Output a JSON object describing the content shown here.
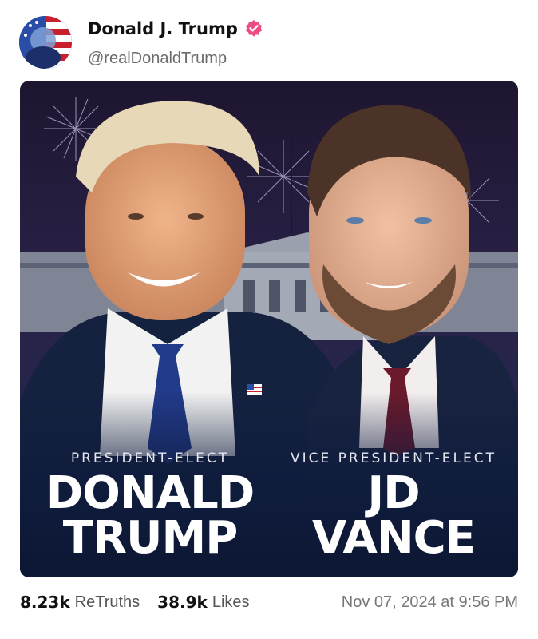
{
  "post": {
    "author_name": "Donald J. Trump",
    "author_handle": "@realDonaldTrump",
    "verified": true,
    "accent_color": "#ec4c86"
  },
  "media": {
    "left": {
      "role": "PRESIDENT-ELECT",
      "name_line1": "DONALD",
      "name_line2": "TRUMP"
    },
    "right": {
      "role": "VICE PRESIDENT-ELECT",
      "name_line1": "JD",
      "name_line2": "VANCE"
    }
  },
  "stats": {
    "retruths_count": "8.23k",
    "retruths_label": "ReTruths",
    "likes_count": "38.9k",
    "likes_label": "Likes",
    "timestamp": "Nov 07, 2024 at 9:56 PM"
  },
  "icons": [
    "verified-badge-icon",
    "flag-pin-icon"
  ]
}
